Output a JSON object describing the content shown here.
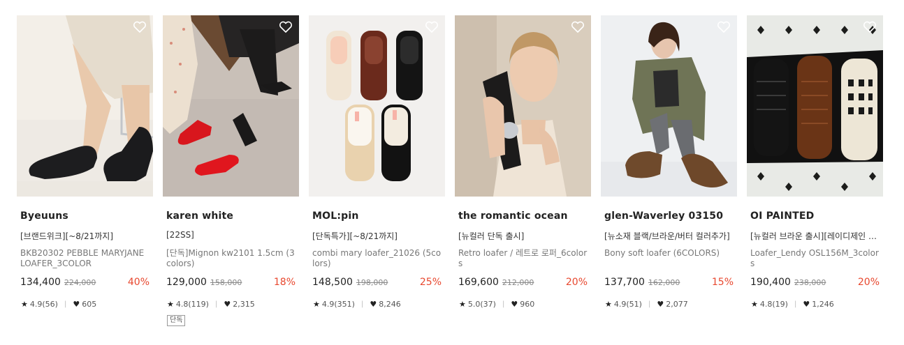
{
  "products": [
    {
      "brand": "Byeuuns",
      "promo": "[브랜드위크][~8/21까지]",
      "name": "BKB20302 PEBBLE MARYJANE LOAFER_3COLOR",
      "price": "134,400",
      "original_price": "224,000",
      "discount": "40%",
      "rating": "4.9(56)",
      "likes": "605",
      "tag": ""
    },
    {
      "brand": "karen white",
      "promo": "[22SS]",
      "name": "[단독]Mignon kw2101 1.5cm (3colors)",
      "price": "129,000",
      "original_price": "158,000",
      "discount": "18%",
      "rating": "4.8(119)",
      "likes": "2,315",
      "tag": "단독"
    },
    {
      "brand": "MOL:pin",
      "promo": "[단독특가][~8/21까지]",
      "name": "combi mary loafer_21026 (5colors)",
      "price": "148,500",
      "original_price": "198,000",
      "discount": "25%",
      "rating": "4.9(351)",
      "likes": "8,246",
      "tag": ""
    },
    {
      "brand": "the romantic ocean",
      "promo": "[뉴컬러 단독 출시]",
      "name": "Retro loafer / 레트로 로퍼_6colors",
      "price": "169,600",
      "original_price": "212,000",
      "discount": "20%",
      "rating": "5.0(37)",
      "likes": "960",
      "tag": ""
    },
    {
      "brand": "glen-Waverley 03150",
      "promo": "[뉴소재 블랙/브라운/버터 컬러추가]",
      "name": "Bony soft loafer (6COLORS)",
      "price": "137,700",
      "original_price": "162,000",
      "discount": "15%",
      "rating": "4.9(51)",
      "likes": "2,077",
      "tag": ""
    },
    {
      "brand": "OI PAINTED",
      "promo": "[뉴컬러 브라운 출시][레이디제인 …",
      "name": "Loafer_Lendy OSL156M_3colors",
      "price": "190,400",
      "original_price": "238,000",
      "discount": "20%",
      "rating": "4.8(19)",
      "likes": "1,246",
      "tag": ""
    }
  ],
  "icons": {
    "wishlist": "heart-outline-icon",
    "rating": "star-icon",
    "likes": "heart-filled-icon"
  },
  "colors": {
    "discount": "#e8482f",
    "text": "#222222",
    "muted": "#777777"
  }
}
